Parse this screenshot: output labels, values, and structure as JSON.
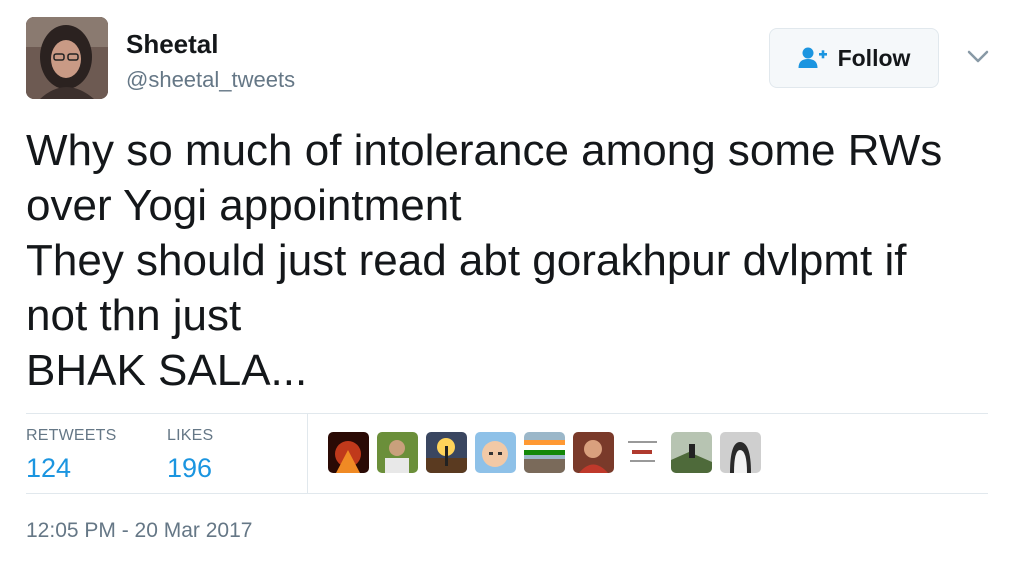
{
  "user": {
    "name": "Sheetal",
    "handle": "@sheetal_tweets"
  },
  "follow_button": {
    "label": "Follow",
    "icon": "add-user-icon"
  },
  "tweet": {
    "lines": [
      "Why so much of intolerance among some RWs",
      "over Yogi appointment",
      "They should just read abt gorakhpur dvlpmt if",
      "not thn just",
      "BHAK SALA..."
    ]
  },
  "stats": {
    "retweets_label": "RETWEETS",
    "retweets_count": "124",
    "likes_label": "LIKES",
    "likes_count": "196"
  },
  "liked_by_count": 9,
  "timestamp": "12:05 PM - 20 Mar 2017",
  "colors": {
    "link_blue": "#1b95e0",
    "muted_gray": "#657786",
    "border": "#e1e8ed",
    "text": "#14171a"
  }
}
